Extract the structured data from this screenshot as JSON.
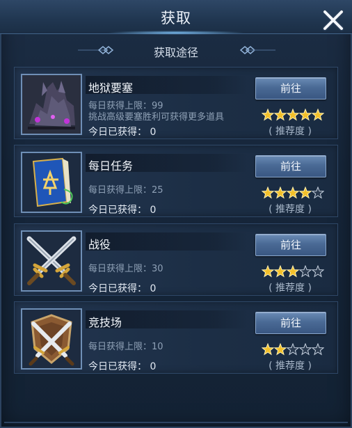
{
  "window": {
    "title": "获取",
    "close_icon": "close-icon"
  },
  "section": {
    "subtitle": "获取途径"
  },
  "colors": {
    "star_filled": "#f3c02a",
    "star_empty": "#2b3b50",
    "button": "#4a6a95"
  },
  "sources": [
    {
      "name": "地狱要塞",
      "icon": "hell-fortress-icon",
      "limit": "每日获得上限：99",
      "desc": "挑战高级要塞胜利可获得更多道具",
      "today": "今日已获得：  0",
      "button": "前往",
      "stars": 5,
      "max_stars": 5,
      "recommend": "( 推荐度 )"
    },
    {
      "name": "每日任务",
      "icon": "quest-book-icon",
      "limit": "每日获得上限：25",
      "desc": "",
      "today": "今日已获得：  0",
      "button": "前往",
      "stars": 4,
      "max_stars": 5,
      "recommend": "( 推荐度 )"
    },
    {
      "name": "战役",
      "icon": "crossed-swords-icon",
      "limit": "每日获得上限：30",
      "desc": "",
      "today": "今日已获得：  0",
      "button": "前往",
      "stars": 3,
      "max_stars": 5,
      "recommend": "( 推荐度 )"
    },
    {
      "name": "竞技场",
      "icon": "arena-shield-icon",
      "limit": "每日获得上限：10",
      "desc": "",
      "today": "今日已获得：  0",
      "button": "前往",
      "stars": 2,
      "max_stars": 5,
      "recommend": "( 推荐度 )"
    }
  ]
}
